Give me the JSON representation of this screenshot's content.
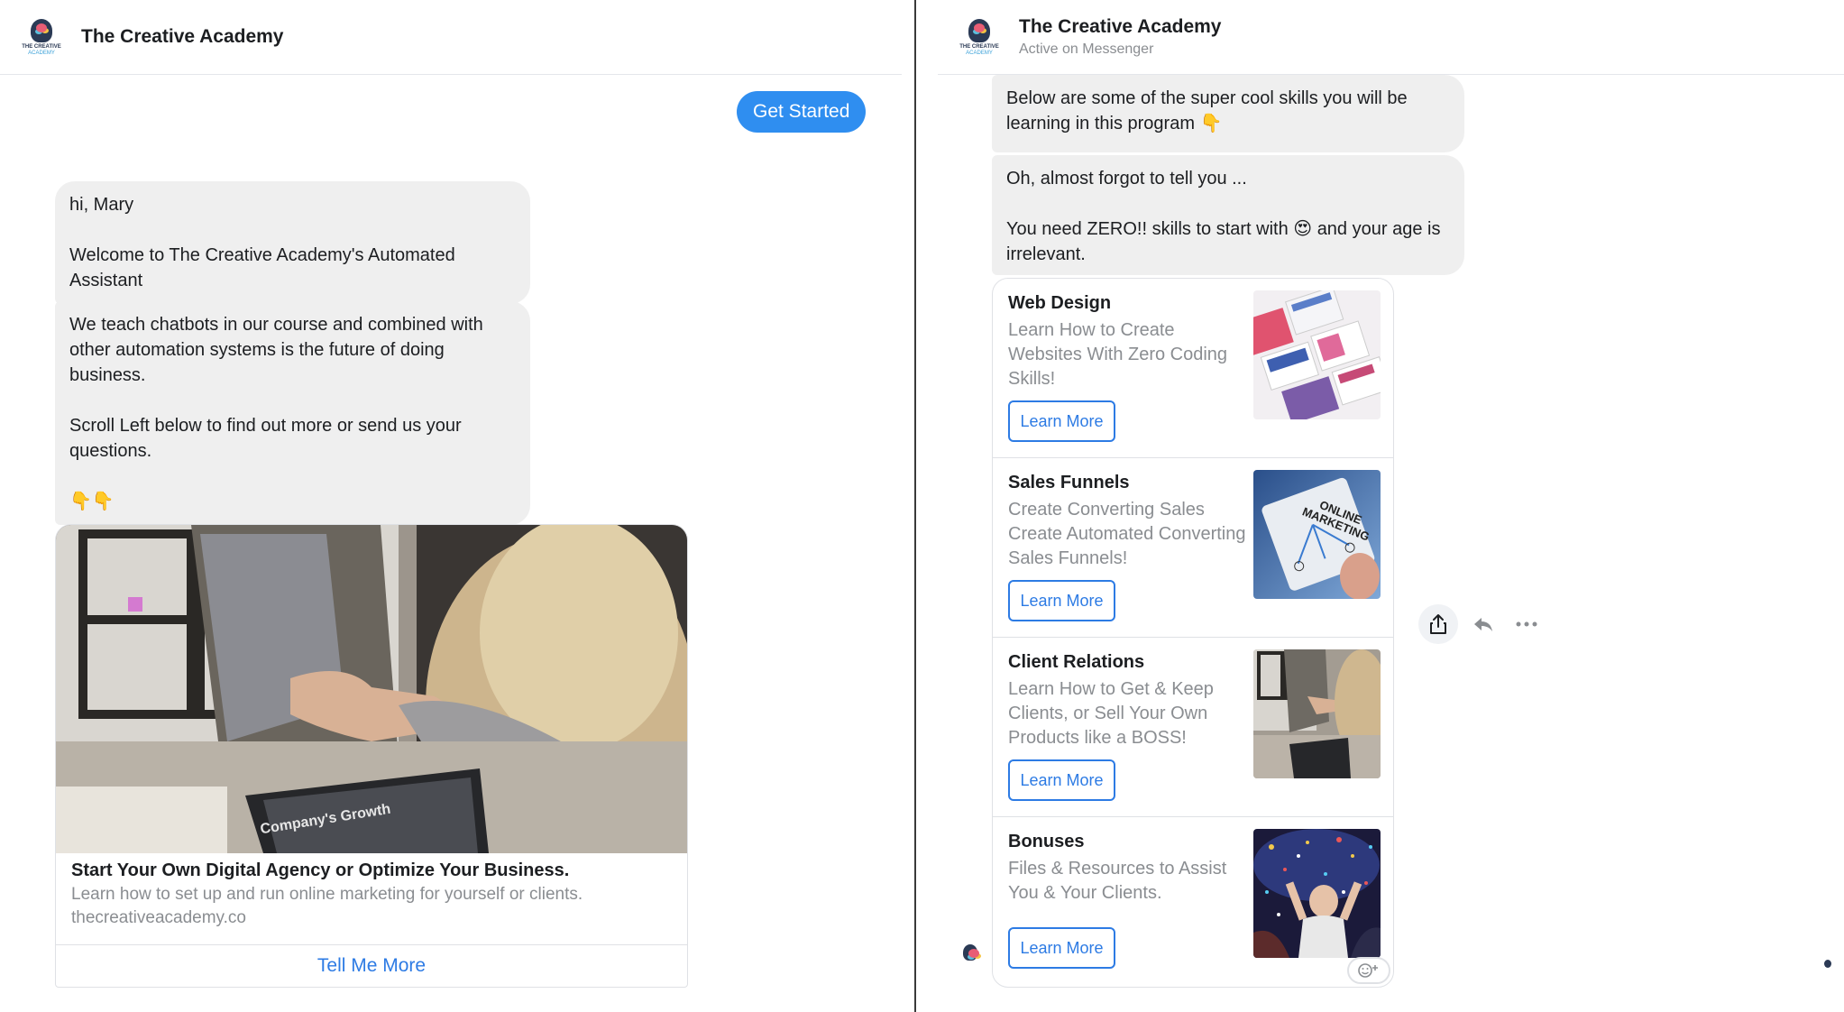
{
  "left": {
    "header": {
      "title": "The Creative Academy",
      "logo_text_1": "THE CREATIVE",
      "logo_text_2": "ACADEMY"
    },
    "get_started_label": "Get Started",
    "bubble_1": "hi, Mary\n\nWelcome to The Creative Academy's Automated Assistant",
    "bubble_2": "We teach chatbots in our course and combined with other automation systems is the future of doing business.\n\nScroll Left below to find out more or send us your questions.\n\n👇👇",
    "card": {
      "photo_caption": "Company's Growth",
      "title": "Start Your Own Digital Agency or Optimize Your Business.",
      "description": "Learn how to set up and run online marketing for yourself or clients.",
      "link": "thecreativeacademy.co",
      "button_label": "Tell Me More"
    }
  },
  "right": {
    "header": {
      "title": "The Creative Academy",
      "subtitle": "Active on Messenger",
      "logo_text_1": "THE CREATIVE",
      "logo_text_2": "ACADEMY"
    },
    "bubble_1": "Below are some of the super cool skills you will be learning in this program 👇",
    "bubble_2": "Oh, almost forgot to tell you ...\n\nYou need ZERO!! skills to start with 😍 and your age is irrelevant.",
    "items": [
      {
        "title": "Web Design",
        "subtitle": "Learn How to Create Websites With Zero Coding Skills!",
        "button_label": "Learn More"
      },
      {
        "title": "Sales Funnels",
        "subtitle": "Create Converting Sales Create Automated Converting Sales Funnels!",
        "button_label": "Learn More",
        "image_text": "ONLINE MARKETING"
      },
      {
        "title": "Client Relations",
        "subtitle": "Learn How to Get & Keep Clients, or Sell Your Own Products like a BOSS!",
        "button_label": "Learn More"
      },
      {
        "title": "Bonuses",
        "subtitle": "Files & Resources to Assist You & Your Clients.",
        "button_label": "Learn More"
      }
    ],
    "icons": [
      "share-icon",
      "reply-icon",
      "more-icon",
      "add-reaction-icon"
    ]
  },
  "colors": {
    "accent": "#2f8ef0",
    "link": "#2d7be4",
    "bubble": "#efefef",
    "muted": "#8a8d91"
  }
}
